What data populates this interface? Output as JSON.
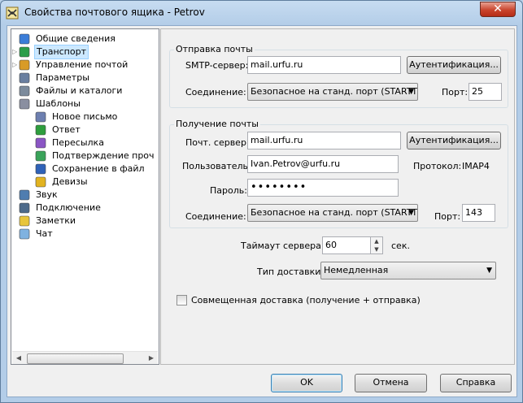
{
  "window": {
    "title": "Свойства почтового ящика - Petrov",
    "close_glyph": "✕"
  },
  "tree": {
    "items": [
      {
        "label": "Общие сведения",
        "icon": "general-info-icon"
      },
      {
        "label": "Транспорт",
        "icon": "transport-icon",
        "selected": true
      },
      {
        "label": "Управление почтой",
        "icon": "mail-management-icon"
      },
      {
        "label": "Параметры",
        "icon": "parameters-icon"
      },
      {
        "label": "Файлы и каталоги",
        "icon": "files-folders-icon"
      },
      {
        "label": "Шаблоны",
        "icon": "templates-icon"
      },
      {
        "label": "Новое письмо",
        "icon": "new-letter-icon"
      },
      {
        "label": "Ответ",
        "icon": "reply-icon"
      },
      {
        "label": "Пересылка",
        "icon": "forward-icon"
      },
      {
        "label": "Подтверждение проч",
        "icon": "read-confirmation-icon"
      },
      {
        "label": "Сохранение в файл",
        "icon": "save-to-file-icon"
      },
      {
        "label": "Девизы",
        "icon": "mottos-icon"
      },
      {
        "label": "Звук",
        "icon": "sound-icon"
      },
      {
        "label": "Подключение",
        "icon": "connection-icon"
      },
      {
        "label": "Заметки",
        "icon": "notes-icon"
      },
      {
        "label": "Чат",
        "icon": "chat-icon"
      }
    ]
  },
  "outgoing": {
    "title": "Отправка почты",
    "server_label": "SMTP-сервер:",
    "server_value": "mail.urfu.ru",
    "auth_button": "Аутентификация...",
    "connection_label": "Соединение:",
    "connection_value": "Безопасное на станд. порт (STARTTLS)",
    "port_label": "Порт:",
    "port_value": "25"
  },
  "incoming": {
    "title": "Получение почты",
    "server_label": "Почт. сервер:",
    "server_value": "mail.urfu.ru",
    "auth_button": "Аутентификация...",
    "user_label": "Пользователь:",
    "user_value": "Ivan.Petrov@urfu.ru",
    "protocol_label": "Протокол:",
    "protocol_value": "IMAP4",
    "password_label": "Пароль:",
    "password_value": "••••••••",
    "connection_label": "Соединение:",
    "connection_value": "Безопасное на станд. порт (STARTTLS)",
    "port_label": "Порт:",
    "port_value": "143"
  },
  "timeout": {
    "label": "Таймаут сервера:",
    "value": "60",
    "unit": "сек."
  },
  "delivery": {
    "label": "Тип доставки:",
    "value": "Немедленная"
  },
  "combined": {
    "label": "Совмещенная доставка (получение + отправка)",
    "checked": false
  },
  "footer": {
    "ok": "OK",
    "cancel": "Отмена",
    "help": "Справка"
  },
  "colors": {
    "selection": "#cce8ff",
    "close_button": "#c9452d"
  }
}
